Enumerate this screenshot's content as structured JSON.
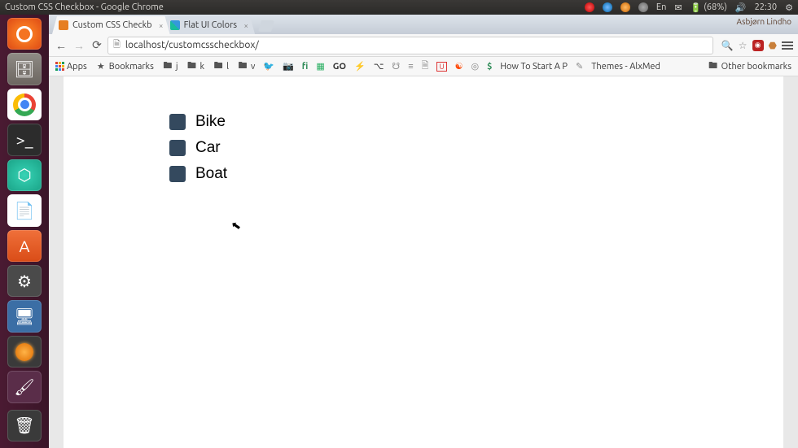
{
  "panel": {
    "title": "Custom CSS Checkbox - Google Chrome",
    "battery": "(68%)",
    "time": "22:30",
    "lang": "En"
  },
  "launcher": [
    {
      "name": "ubuntu-dash",
      "cls": "ubuntu"
    },
    {
      "name": "files",
      "cls": "files"
    },
    {
      "name": "chrome",
      "cls": "chrome"
    },
    {
      "name": "terminal",
      "cls": "term"
    },
    {
      "name": "atom",
      "cls": "green"
    },
    {
      "name": "writer",
      "cls": "writer"
    },
    {
      "name": "software",
      "cls": "sw"
    },
    {
      "name": "settings",
      "cls": "set"
    },
    {
      "name": "displays",
      "cls": "disp"
    },
    {
      "name": "updates",
      "cls": "up"
    },
    {
      "name": "brush",
      "cls": "brush"
    },
    {
      "name": "trash",
      "cls": "trash"
    }
  ],
  "tabs": [
    {
      "label": "Custom CSS Checkb",
      "active": true,
      "fav": "css"
    },
    {
      "label": "Flat UI Colors",
      "active": false,
      "fav": "flat"
    }
  ],
  "tabstrip_user": "Asbjørn Lindho",
  "toolbar": {
    "url": "localhost/customcsscheckbox/"
  },
  "bookmarks": {
    "apps": "Apps",
    "bookmarks": "Bookmarks",
    "folders": [
      "j",
      "k",
      "l",
      "v"
    ],
    "howto": "How To Start A P",
    "themes": "Themes - AlxMed",
    "other": "Other bookmarks"
  },
  "checkboxes": [
    {
      "label": "Bike",
      "checked": false
    },
    {
      "label": "Car",
      "checked": false
    },
    {
      "label": "Boat",
      "checked": false
    }
  ]
}
